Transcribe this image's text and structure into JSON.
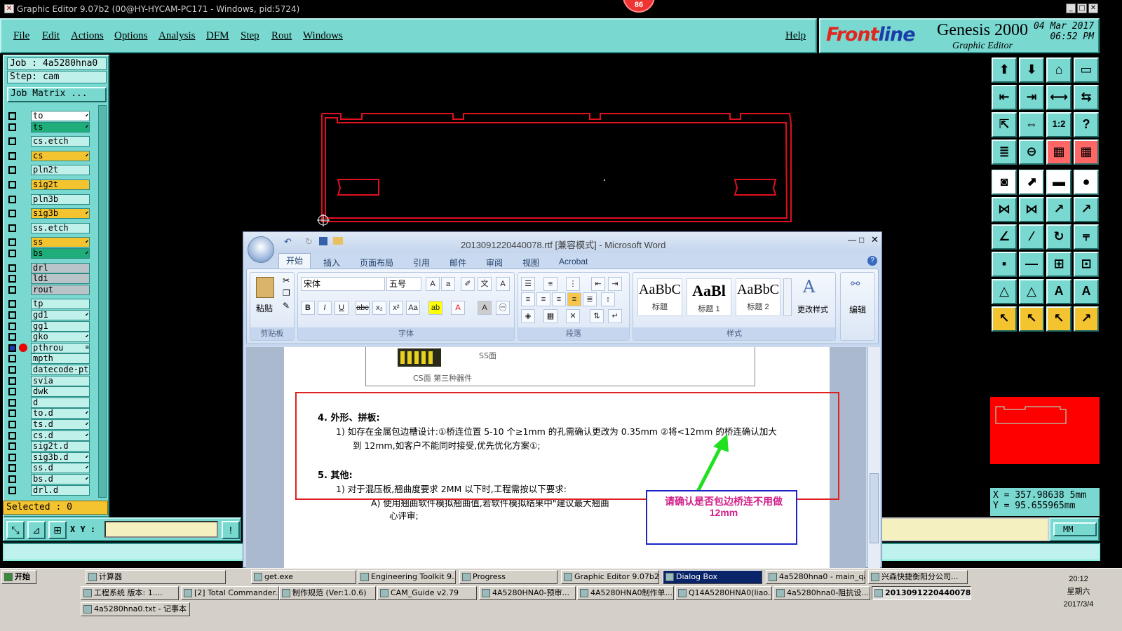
{
  "titlebar": {
    "title": "Graphic Editor 9.07b2 (00@HY-HYCAM-PC171 - Windows, pid:5724)",
    "badge": "86"
  },
  "menu": {
    "items": [
      "File",
      "Edit",
      "Actions",
      "Options",
      "Analysis",
      "DFM",
      "Step",
      "Rout",
      "Windows"
    ],
    "help": "Help"
  },
  "brand": {
    "frontline_a": "Front",
    "frontline_b": "line",
    "product": "Genesis 2000",
    "subtitle": "Graphic Editor",
    "date": "04 Mar 2017",
    "time": "06:52 PM"
  },
  "job": {
    "job_line": "Job : 4a5280hna0",
    "step_line": "Step: cam",
    "matrix_button": "Job Matrix ..."
  },
  "layers": [
    {
      "name": "to",
      "bg": "#ffffff",
      "mark": "⬋"
    },
    {
      "name": "ts",
      "bg": "#1fae7a",
      "mark": "⬋"
    },
    {
      "name": "cs.etch",
      "bg": "#bff0ea",
      "mark": ""
    },
    {
      "name": "cs",
      "bg": "#f4c430",
      "mark": "⬋"
    },
    {
      "name": "pln2t",
      "bg": "#bff0ea",
      "mark": ""
    },
    {
      "name": "sig2t",
      "bg": "#f4c430",
      "mark": ""
    },
    {
      "name": "pln3b",
      "bg": "#bff0ea",
      "mark": ""
    },
    {
      "name": "sig3b",
      "bg": "#f4c430",
      "mark": "⬋"
    },
    {
      "name": "ss.etch",
      "bg": "#bff0ea",
      "mark": ""
    },
    {
      "name": "ss",
      "bg": "#f4c430",
      "mark": "⬋"
    },
    {
      "name": "bs",
      "bg": "#1fae7a",
      "mark": "⬋"
    },
    {
      "name": "drl",
      "bg": "#b8c4c8",
      "mark": ""
    },
    {
      "name": "ldi",
      "bg": "#b8c4c8",
      "mark": ""
    },
    {
      "name": "rout",
      "bg": "#b8c4c8",
      "mark": ""
    },
    {
      "name": "tp",
      "bg": "#bff0ea",
      "mark": ""
    },
    {
      "name": "gd1",
      "bg": "#bff0ea",
      "mark": "⬋"
    },
    {
      "name": "gg1",
      "bg": "#bff0ea",
      "mark": ""
    },
    {
      "name": "gko",
      "bg": "#bff0ea",
      "mark": "⬋"
    },
    {
      "name": "pthrou",
      "bg": "#bff0ea",
      "mark": "≡"
    },
    {
      "name": "mpth",
      "bg": "#bff0ea",
      "mark": ""
    },
    {
      "name": "datecode-pt",
      "bg": "#bff0ea",
      "mark": ""
    },
    {
      "name": "svia",
      "bg": "#bff0ea",
      "mark": ""
    },
    {
      "name": "dwk",
      "bg": "#bff0ea",
      "mark": ""
    },
    {
      "name": "d",
      "bg": "#bff0ea",
      "mark": ""
    },
    {
      "name": "to.d",
      "bg": "#bff0ea",
      "mark": "⬋"
    },
    {
      "name": "ts.d",
      "bg": "#bff0ea",
      "mark": "⬋"
    },
    {
      "name": "cs.d",
      "bg": "#bff0ea",
      "mark": "⬋"
    },
    {
      "name": "sig2t.d",
      "bg": "#bff0ea",
      "mark": ""
    },
    {
      "name": "sig3b.d",
      "bg": "#bff0ea",
      "mark": "⬋"
    },
    {
      "name": "ss.d",
      "bg": "#bff0ea",
      "mark": "⬋"
    },
    {
      "name": "bs.d",
      "bg": "#bff0ea",
      "mark": "⬋"
    },
    {
      "name": "drl.d",
      "bg": "#bff0ea",
      "mark": ""
    }
  ],
  "selected": "Selected : 0",
  "xy_label": "X Y :",
  "unit": "MM",
  "coords": {
    "x": "X  =  357.98638 5mm",
    "y": "Y  =  95.655965mm"
  },
  "word": {
    "title": "2013091220440078.rtf [兼容模式] - Microsoft Word",
    "tabs": [
      "开始",
      "插入",
      "页面布局",
      "引用",
      "邮件",
      "审阅",
      "视图",
      "Acrobat"
    ],
    "groups": {
      "clipboard": "剪贴板",
      "font": "字体",
      "paragraph": "段落",
      "styles": "样式"
    },
    "paste": "粘贴",
    "font_name": "宋体",
    "font_size": "五号",
    "styles": [
      {
        "sample": "AaBbC",
        "label": "标题"
      },
      {
        "sample": "AaBl",
        "label": "标题 1"
      },
      {
        "sample": "AaBbC",
        "label": "标题 2"
      }
    ],
    "change_styles": "更改样式",
    "edit": "编辑",
    "doc": {
      "img_caption_ss": "SS面",
      "img_caption_cs": "CS面  第三种器件",
      "h4": "4.   外形、拼板:",
      "p4a": "1) 如存在金属包边槽设计:①桥连位置 5-10 个≥1mm 的孔需确认更改为 0.35mm ②将<12mm 的桥连确认加大",
      "p4b": "到 12mm,如客户不能同时接受,优先优化方案①;",
      "h5": "5.   其他:",
      "p5a": "1) 对于混压板,翘曲度要求 2MM 以下时,工程需按以下要求:",
      "p5b": "A) 使用翘曲软件模拟翘曲值,若软件模拟结果中\"建议最大翘曲",
      "p5c": "心评审;",
      "callout": "请确认是否包边桥连不用做12mm"
    }
  },
  "taskbar": {
    "start": "开始",
    "row1": [
      "计算器",
      "get.exe",
      "Engineering Toolkit 9....",
      "Progress",
      "Graphic Editor 9.07b2 ...",
      "Dialog Box",
      "4a5280hna0 - main_qa",
      "兴森快捷衡阳分公司..."
    ],
    "row2": [
      "工程系统  版本: 1....",
      "[2] Total Commander...",
      "制作规范 (Ver:1.0.6)",
      "CAM_Guide v2.79",
      "4A5280HNA0-预审...",
      "4A5280HNA0制作单...",
      "Q14A5280HNA0(liao...",
      "4a5280hna0-阻抗设...",
      "2013091220440078..."
    ],
    "row3": [
      "4a5280hna0.txt - 记事本"
    ],
    "time": "20:12",
    "weekday": "星期六",
    "date": "2017/3/4"
  },
  "colors": {
    "panel": "#79d8d0",
    "outline": "#e01020",
    "highlight_red": "#e02020",
    "callout_blue": "#1a25c8",
    "arrow_green": "#20e020"
  }
}
